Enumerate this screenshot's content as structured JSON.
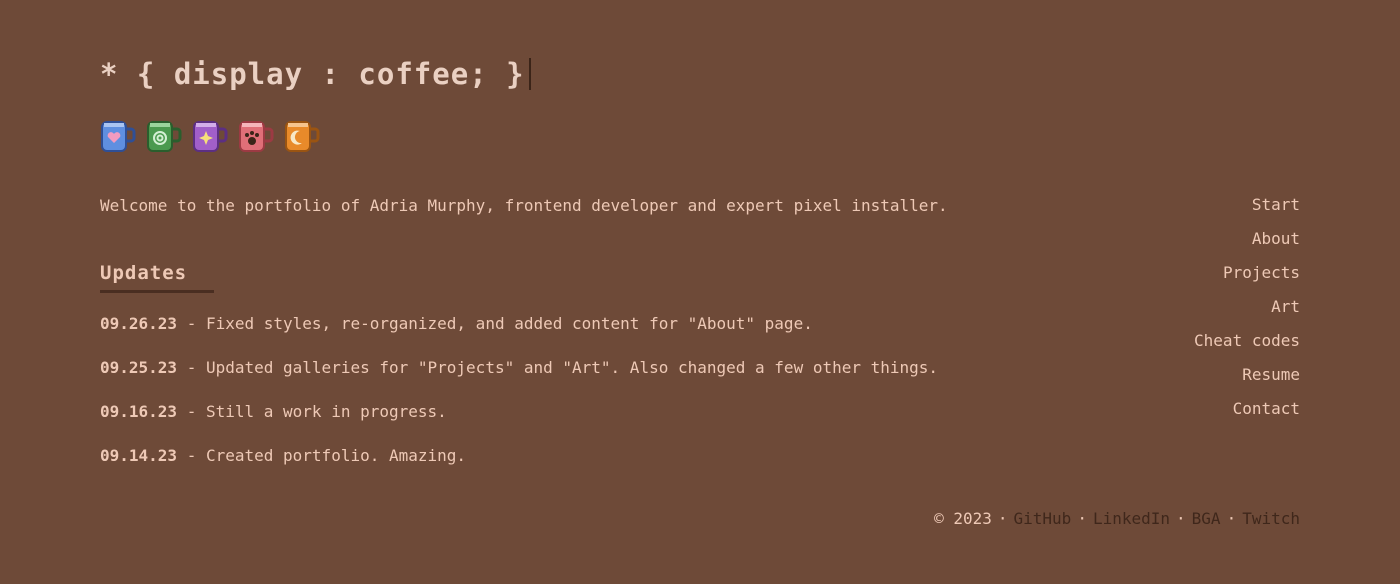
{
  "header": {
    "logo_text": "* { display : coffee; }"
  },
  "mugs": [
    {
      "name": "heart-mug-icon",
      "color": "#5f8fe0",
      "emblem": "heart"
    },
    {
      "name": "spiral-mug-icon",
      "color": "#4b9a4f",
      "emblem": "spiral"
    },
    {
      "name": "sparkle-mug-icon",
      "color": "#a15fc9",
      "emblem": "sparkle"
    },
    {
      "name": "paw-mug-icon",
      "color": "#e06f78",
      "emblem": "paw"
    },
    {
      "name": "moon-mug-icon",
      "color": "#e88a2a",
      "emblem": "moon"
    }
  ],
  "intro": "Welcome to the portfolio of Adria Murphy, frontend developer and expert pixel installer.",
  "updates": {
    "heading": "Updates",
    "items": [
      {
        "date": "09.26.23",
        "text": " - Fixed styles, re-organized, and added content for \"About\" page."
      },
      {
        "date": "09.25.23",
        "text": " - Updated galleries for \"Projects\" and \"Art\". Also changed a few other things."
      },
      {
        "date": "09.16.23",
        "text": " - Still a work in progress."
      },
      {
        "date": "09.14.23",
        "text": " - Created portfolio. Amazing."
      }
    ]
  },
  "nav": {
    "items": [
      "Start",
      "About",
      "Projects",
      "Art",
      "Cheat codes",
      "Resume",
      "Contact"
    ]
  },
  "footer": {
    "copyright": "© 2023",
    "separator": "·",
    "links": [
      "GitHub",
      "LinkedIn",
      "BGA",
      "Twitch"
    ]
  },
  "colors": {
    "background": "#6e4a38",
    "text": "#eec9b6",
    "footer_link": "#3f271b"
  }
}
